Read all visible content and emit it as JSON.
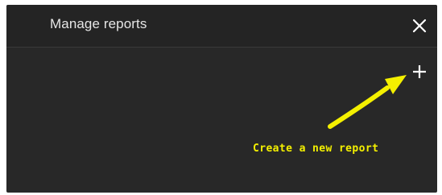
{
  "dialog": {
    "title": "Manage reports",
    "close_icon": "close-icon",
    "add_icon": "plus-icon"
  },
  "annotation": {
    "text": "Create a new report",
    "color": "#f4f000"
  },
  "colors": {
    "dialog_background": "#282828",
    "header_background": "#242424",
    "text": "#e6e6e6"
  }
}
